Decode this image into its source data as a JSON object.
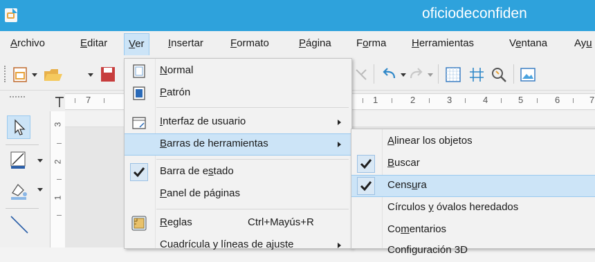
{
  "window": {
    "title": "oficiodeconfiden"
  },
  "menubar": {
    "items": [
      {
        "pre": "",
        "u": "A",
        "post": "rchivo"
      },
      {
        "pre": "",
        "u": "E",
        "post": "ditar"
      },
      {
        "pre": "",
        "u": "V",
        "post": "er"
      },
      {
        "pre": "",
        "u": "I",
        "post": "nsertar"
      },
      {
        "pre": "",
        "u": "F",
        "post": "ormato"
      },
      {
        "pre": "",
        "u": "P",
        "post": "ágina"
      },
      {
        "pre": "F",
        "u": "o",
        "post": "rma"
      },
      {
        "pre": "",
        "u": "H",
        "post": "erramientas"
      },
      {
        "pre": "V",
        "u": "e",
        "post": "ntana"
      },
      {
        "pre": "Ay",
        "u": "u",
        "post": ""
      }
    ]
  },
  "ruler": {
    "numbers": [
      "7",
      "1",
      "2",
      "3",
      "4",
      "5",
      "6",
      "7"
    ]
  },
  "vruler": {
    "numbers": [
      "3",
      "2",
      "1"
    ]
  },
  "ver_menu": {
    "items": [
      {
        "pre": "",
        "u": "N",
        "post": "ormal",
        "icon": "normal-view-icon"
      },
      {
        "pre": "",
        "u": "P",
        "post": "atrón",
        "icon": "master-view-icon"
      },
      {
        "pre": "",
        "u": "I",
        "post": "nterfaz de usuario",
        "icon": "user-interface-icon",
        "submenu": true
      },
      {
        "pre": "",
        "u": "B",
        "post": "arras de herramientas",
        "submenu": true,
        "highlight": true
      },
      {
        "pre": "Barra de e",
        "u": "s",
        "post": "tado",
        "checked": true
      },
      {
        "pre": "",
        "u": "P",
        "post": "anel de páginas"
      },
      {
        "pre": "",
        "u": "R",
        "post": "eglas",
        "icon": "rulers-icon",
        "shortcut": "Ctrl+Mayús+R"
      },
      {
        "pre": "Cuadrícula y líneas de ajuste",
        "u": "",
        "post": "",
        "submenu": true
      }
    ]
  },
  "toolbars_menu": {
    "items": [
      {
        "pre": "",
        "u": "A",
        "post": "linear los objetos",
        "checked": false
      },
      {
        "pre": "",
        "u": "B",
        "post": "uscar",
        "checked": true
      },
      {
        "pre": "Cens",
        "u": "u",
        "post": "ra",
        "checked": true,
        "highlight": true
      },
      {
        "pre": "Círculos ",
        "u": "y",
        "post": " óvalos heredados",
        "checked": false
      },
      {
        "pre": "Co",
        "u": "m",
        "post": "entarios",
        "checked": false
      },
      {
        "pre": "Configuración 3D",
        "u": "",
        "post": "",
        "checked": false
      }
    ]
  },
  "colors": {
    "titlebar": "#2ea2dc",
    "highlight": "#cce4f7",
    "highlight_border": "#99c9ef"
  }
}
